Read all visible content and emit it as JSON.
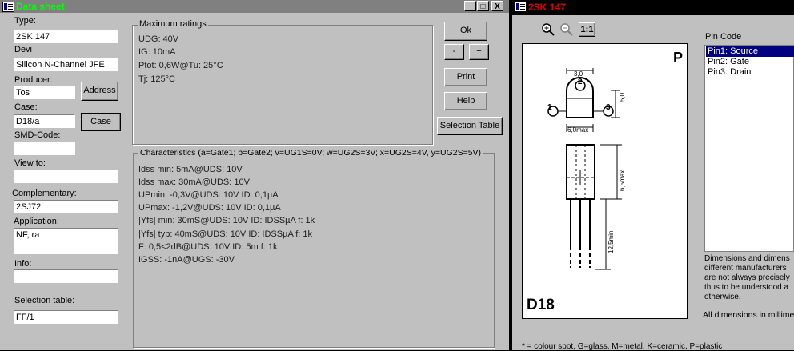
{
  "datasheet": {
    "title": "Data sheet",
    "window_controls": {
      "minimize": "_",
      "maximize": "□",
      "close": "X"
    },
    "fields": {
      "type": {
        "label": "Type:",
        "value": "2SK 147"
      },
      "device": {
        "label": "Devi",
        "value": "Silicon N-Channel JFE"
      },
      "producer": {
        "label": "Producer:",
        "value": "Tos"
      },
      "case": {
        "label": "Case:",
        "value": "D18/a"
      },
      "smd_code": {
        "label": "SMD-Code:",
        "value": ""
      },
      "view_to": {
        "label": "View to:",
        "value": ""
      },
      "complementary": {
        "label": "Complementary:",
        "value": "2SJ72"
      },
      "application": {
        "label": "Application:",
        "value": "NF, ra"
      },
      "info": {
        "label": "Info:",
        "value": ""
      },
      "selection_table": {
        "label": "Selection table:",
        "value": "FF/1"
      }
    },
    "buttons": {
      "address": "Address",
      "case": "Case",
      "ok": "Ok",
      "minus": "-",
      "plus": "+",
      "print": "Print",
      "help": "Help",
      "selection_table": "Selection Table"
    },
    "max_ratings": {
      "title": "Maximum ratings",
      "lines": [
        "UDG: 40V",
        "IG: 10mA",
        "Ptot: 0,6W@Tu: 25°C",
        "Tj: 125°C"
      ]
    },
    "characteristics": {
      "title": "Characteristics (a=Gate1; b=Gate2; v=UG1S=0V; w=UG2S=3V; x=UG2S=4V, y=UG2S=5V)",
      "lines": [
        "Idss min: 5mA@UDS: 10V",
        "Idss max: 30mA@UDS: 10V",
        "UPmin: -0,3V@UDS: 10V ID: 0,1µA",
        "UPmax: -1,2V@UDS: 10V ID: 0,1µA",
        "|Yfs| min: 30mS@UDS: 10V ID: IDSSµA f: 1k",
        "|Yfs| typ: 40mS@UDS: 10V ID: IDSSµA f: 1k",
        "F: 0,5<2dB@UDS: 10V ID: 5m f: 1k",
        "IGSS: -1nA@UGS: -30V"
      ]
    }
  },
  "case_view": {
    "title": "2SK 147",
    "tools": {
      "zoom_in": "zoom-in-icon",
      "zoom_out": "zoom-out-icon",
      "actual_size": "1:1"
    },
    "drawing": {
      "corner_letter": "P",
      "case_name": "D18",
      "pin_labels": [
        "1",
        "2",
        "3"
      ],
      "dims": [
        "3,0",
        "5,0",
        "6,0max",
        "6,5max",
        "12,5min"
      ]
    },
    "pin_code": {
      "label": "Pin Code",
      "items": [
        "Pin1: Source",
        "Pin2: Gate",
        "Pin3: Drain"
      ],
      "selected_index": 0
    },
    "notes": [
      "Dimensions and dimens",
      "different manufacturers",
      "are not always precisely",
      "thus to be understood a",
      "otherwise."
    ],
    "all_dims": "All dimensions in millimet",
    "footer": "* = colour spot, G=glass, M=metal, K=ceramic, P=plastic"
  },
  "colors": {
    "title_green": "#00ff00",
    "title2_red": "#e00000",
    "selection": "#000080",
    "face": "#c0c0c0"
  }
}
